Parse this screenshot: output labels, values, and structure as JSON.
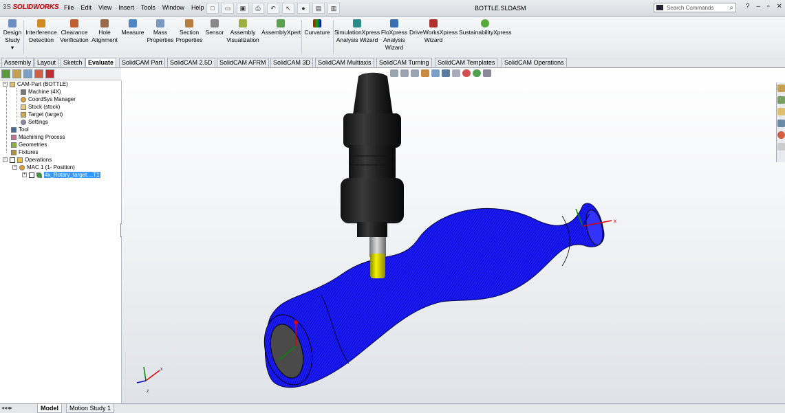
{
  "app": {
    "logo": "SOLIDWORKS",
    "logo_prefix": "3S",
    "document_title": "BOTTLE.SLDASM"
  },
  "menu": [
    "File",
    "Edit",
    "View",
    "Insert",
    "Tools",
    "Window",
    "Help"
  ],
  "search": {
    "placeholder": "Search Commands"
  },
  "window_controls": [
    "?",
    "–",
    "▫",
    "✕"
  ],
  "ribbon": {
    "design_study": {
      "line1": "Design",
      "line2": "Study"
    },
    "buttons": [
      {
        "line1": "Interference",
        "line2": "Detection",
        "icon": "interference-icon"
      },
      {
        "line1": "Clearance",
        "line2": "Verification",
        "icon": "clearance-icon"
      },
      {
        "line1": "Hole",
        "line2": "Alignment",
        "icon": "hole-icon"
      },
      {
        "line1": "Measure",
        "line2": "",
        "icon": "measure-icon"
      },
      {
        "line1": "Mass",
        "line2": "Properties",
        "icon": "mass-icon"
      },
      {
        "line1": "Section",
        "line2": "Properties",
        "icon": "section-icon"
      },
      {
        "line1": "Sensor",
        "line2": "",
        "icon": "sensor-icon"
      },
      {
        "line1": "Assembly",
        "line2": "Visualization",
        "icon": "assembly-vis-icon"
      },
      {
        "line1": "AssemblyXpert",
        "line2": "",
        "icon": "assemblyxpert-icon"
      },
      {
        "line1": "Curvature",
        "line2": "",
        "icon": "curvature-icon"
      },
      {
        "line1": "SimulationXpress",
        "line2": "Analysis Wizard",
        "icon": "simulation-icon"
      },
      {
        "line1": "FloXpress",
        "line2": "Analysis",
        "line3": "Wizard",
        "icon": "floxpress-icon"
      },
      {
        "line1": "DriveWorksXpress",
        "line2": "Wizard",
        "icon": "driveworks-icon"
      },
      {
        "line1": "SustainabilityXpress",
        "line2": "",
        "icon": "sustainability-icon"
      }
    ]
  },
  "tabs": [
    "Assembly",
    "Layout",
    "Sketch",
    "Evaluate",
    "SolidCAM Part",
    "SolidCAM 2.5D",
    "SolidCAM AFRM",
    "SolidCAM 3D",
    "SolidCAM Multiaxis",
    "SolidCAM Turning",
    "SolidCAM Templates",
    "SolidCAM Operations"
  ],
  "active_tab": "Evaluate",
  "tree": {
    "root": "CAM-Part (BOTTLE)",
    "items": [
      "Machine (4X)",
      "CoordSys Manager",
      "Stock (stock)",
      "Target (target)",
      "Settings"
    ],
    "tool": "Tool",
    "machining_process": "Machining Process",
    "geometries": "Geometries",
    "fixtures": "Fixtures",
    "operations": "Operations",
    "mac": "MAC 1 (1- Position)",
    "operation": "4x_Rotary_target....T1"
  },
  "bottom_tabs": [
    "Model",
    "Motion Study 1"
  ],
  "colors": {
    "toolpath": "#1a1aff",
    "selection": "#3399ff",
    "tool_holder": "#2a2a2a",
    "tool_shank": "#e8e000"
  }
}
